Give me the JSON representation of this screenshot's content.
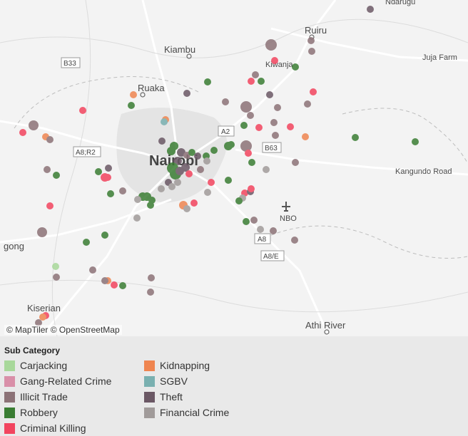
{
  "map": {
    "places": [
      {
        "name": "Ndarugu"
      },
      {
        "name": "Ruiru"
      },
      {
        "name": "Kiambu"
      },
      {
        "name": "Juja Farm"
      },
      {
        "name": "Kiwanja"
      },
      {
        "name": "Ruaka"
      },
      {
        "name": "Nairobi"
      },
      {
        "name": "Kangundo Road"
      },
      {
        "name": "NBO"
      },
      {
        "name": "gong"
      },
      {
        "name": "Kiserian"
      },
      {
        "name": "Athi River"
      }
    ],
    "road_shields": [
      {
        "label": "B33"
      },
      {
        "label": "A2"
      },
      {
        "label": "A8;R2"
      },
      {
        "label": "B63"
      },
      {
        "label": "A8"
      },
      {
        "label": "A8/E"
      }
    ],
    "attribution": "© MapTiler  © OpenStreetMap"
  },
  "legend": {
    "title": "Sub Category",
    "items": [
      {
        "label": "Carjacking",
        "color": "#a8d89a"
      },
      {
        "label": "Gang-Related Crime",
        "color": "#d98fa8"
      },
      {
        "label": "Illicit Trade",
        "color": "#8c7277"
      },
      {
        "label": "Robbery",
        "color": "#3a7d33"
      },
      {
        "label": "Criminal Killing",
        "color": "#f2455f"
      },
      {
        "label": "Kidnapping",
        "color": "#ef8550"
      },
      {
        "label": "SGBV",
        "color": "#7ab0b0"
      },
      {
        "label": "Theft",
        "color": "#6b5865"
      },
      {
        "label": "Financial Crime",
        "color": "#a19b9a"
      }
    ]
  },
  "chart_data": {
    "type": "scatter",
    "title": "",
    "legend_title": "Sub Category"
  }
}
